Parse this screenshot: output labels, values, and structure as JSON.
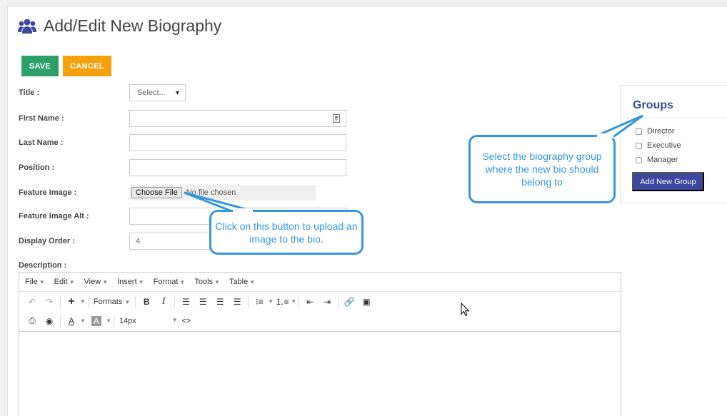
{
  "header": {
    "title": "Add/Edit New Biography",
    "icon": "users-icon"
  },
  "actions": {
    "save": "SAVE",
    "cancel": "CANCEL"
  },
  "form": {
    "title_label": "Title :",
    "title_value": "Select...",
    "first_name_label": "First Name :",
    "last_name_label": "Last Name :",
    "position_label": "Position :",
    "feature_image_label": "Feature Image :",
    "choose_file": "Choose File",
    "no_file": "No file chosen",
    "feature_alt_label": "Feature Image Alt :",
    "display_order_label": "Display Order :",
    "display_order_value": "4",
    "description_label": "Description :"
  },
  "groups": {
    "title": "Groups",
    "items": [
      "Director",
      "Executive",
      "Manager"
    ],
    "add_button": "Add New Group"
  },
  "editor": {
    "menus": [
      "File",
      "Edit",
      "View",
      "Insert",
      "Format",
      "Tools",
      "Table"
    ],
    "formats": "Formats",
    "font_size": "14px",
    "bold": "B",
    "italic": "I",
    "font_color": "A",
    "bg_color": "A",
    "code": "<>"
  },
  "callouts": {
    "file": "Click on this button to upload an image to the bio.",
    "groups": "Select the biography group where the new bio should belong to"
  },
  "colors": {
    "save": "#2f9f6a",
    "cancel": "#f4a10d",
    "accent": "#3e479c",
    "callout": "#3498db"
  }
}
